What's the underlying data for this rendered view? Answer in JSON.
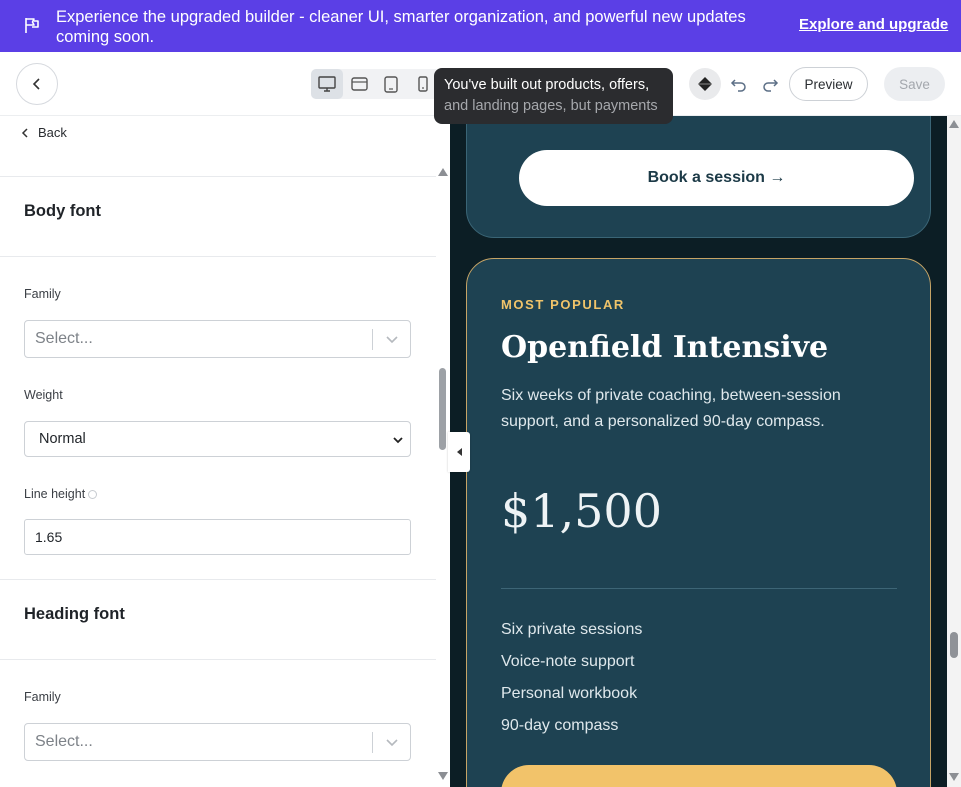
{
  "banner": {
    "message": "Experience the upgraded builder - cleaner UI, smarter organization, and powerful new updates coming soon.",
    "cta": "Explore and upgrade",
    "icon": "flag-icon",
    "bg_color": "#5b3fe6"
  },
  "toolbar": {
    "devices": [
      "desktop",
      "tablet-landscape",
      "tablet-portrait",
      "mobile"
    ],
    "active_device": "desktop",
    "tooltip_line1": "You've built out products, offers,",
    "tooltip_line2": "and landing pages, but payments",
    "preview_label": "Preview",
    "save_label": "Save"
  },
  "panel": {
    "back_label": "Back",
    "body_font": {
      "title": "Body font",
      "family_label": "Family",
      "family_placeholder": "Select...",
      "weight_label": "Weight",
      "weight_value": "Normal",
      "line_height_label": "Line height",
      "line_height_value": "1.65"
    },
    "heading_font": {
      "title": "Heading font",
      "family_label": "Family",
      "family_placeholder": "Select..."
    }
  },
  "preview": {
    "book_button": "Book a session →",
    "plan": {
      "badge": "MOST POPULAR",
      "title": "Openfield Intensive",
      "description": "Six weeks of private coaching, between-session support, and a personalized 90-day compass.",
      "price": "$1,500",
      "features": [
        "Six private sessions",
        "Voice-note support",
        "Personal workbook",
        "90-day compass"
      ]
    },
    "colors": {
      "page_bg": "#0c1e25",
      "card_bg": "#1e4252",
      "accent_gold": "#f2c36a"
    }
  }
}
